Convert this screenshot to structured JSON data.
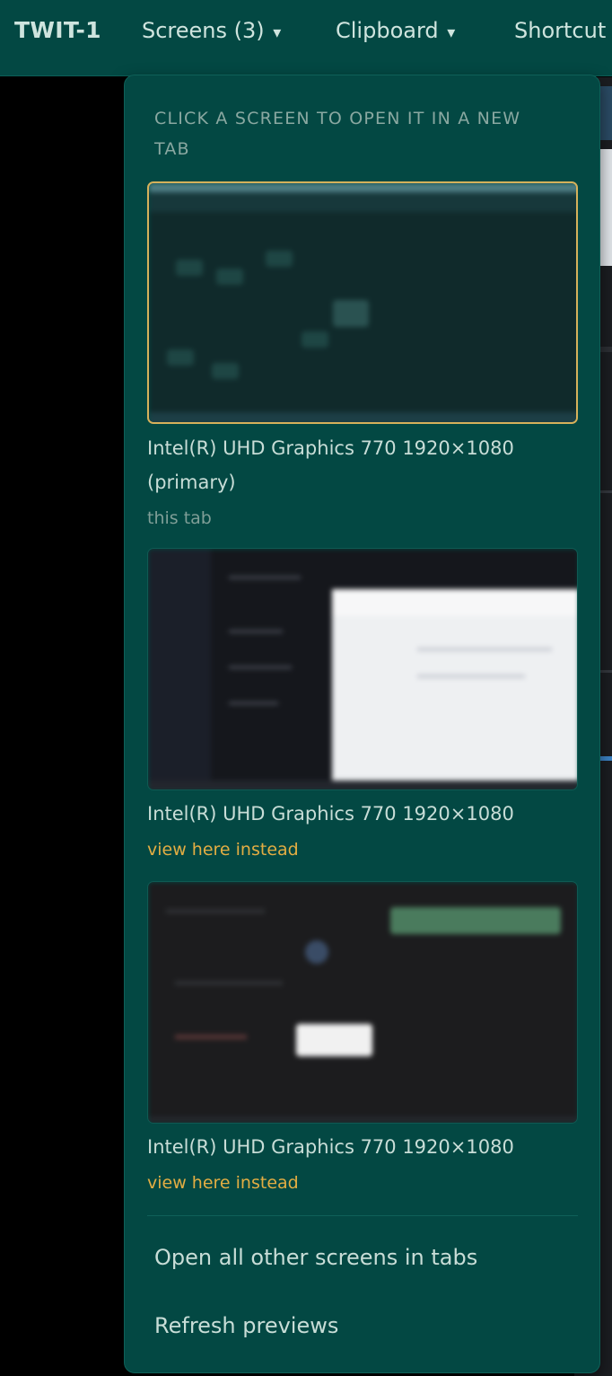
{
  "topbar": {
    "brand": "TWIT-1",
    "nav": [
      {
        "label": "Screens (3)",
        "caret": "▾"
      },
      {
        "label": "Clipboard",
        "caret": "▾"
      },
      {
        "label": "Shortcut"
      }
    ]
  },
  "screens_dropdown": {
    "header": "CLICK A SCREEN TO OPEN IT IN A NEW TAB",
    "screens": [
      {
        "name": "Intel(R) UHD Graphics 770 1920×1080 (primary)",
        "status": "this tab",
        "selected": true
      },
      {
        "name": "Intel(R) UHD Graphics 770 1920×1080",
        "action": "view here instead",
        "selected": false
      },
      {
        "name": "Intel(R) UHD Graphics 770 1920×1080",
        "action": "view here instead",
        "selected": false
      }
    ],
    "actions": {
      "open_all": "Open all other screens in tabs",
      "refresh": "Refresh previews"
    }
  },
  "colors": {
    "bar_background": "#034843",
    "accent_link": "#e3ad43",
    "selected_border": "#d6b15b"
  }
}
